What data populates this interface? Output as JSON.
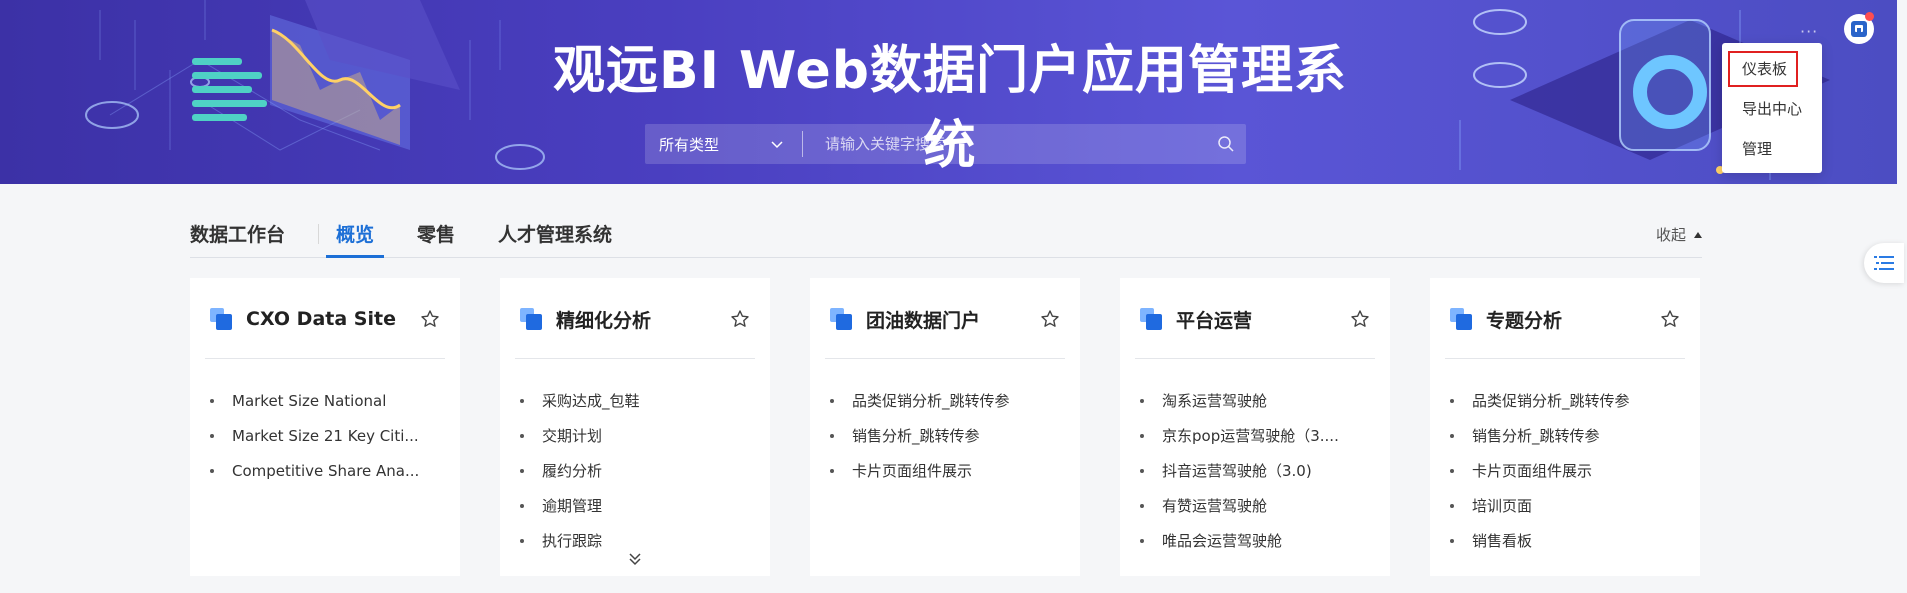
{
  "header": {
    "title": "观远BI Web数据门户应用管理系统",
    "search": {
      "type_selected": "所有类型",
      "placeholder": "请输入关键字搜索"
    },
    "more_label": "···"
  },
  "user_menu": {
    "items": [
      "仪表板",
      "导出中心",
      "管理"
    ],
    "highlighted": "仪表板"
  },
  "workspace": {
    "title": "数据工作台",
    "tabs": [
      "概览",
      "零售",
      "人才管理系统"
    ],
    "active_tab": "概览",
    "collapse_label": "收起"
  },
  "cards": [
    {
      "title": "CXO Data Site",
      "items": [
        "Market Size National",
        "Market Size 21 Key Citi...",
        "Competitive Share Ana..."
      ]
    },
    {
      "title": "精细化分析",
      "items": [
        "采购达成_包鞋",
        "交期计划",
        "履约分析",
        "逾期管理",
        "执行跟踪"
      ]
    },
    {
      "title": "团油数据门户",
      "items": [
        "品类促销分析_跳转传参",
        "销售分析_跳转传参",
        "卡片页面组件展示"
      ]
    },
    {
      "title": "平台运营",
      "items": [
        "淘系运营驾驶舱",
        "京东pop运营驾驶舱（3....",
        "抖音运营驾驶舱（3.0)",
        "有赞运营驾驶舱",
        "唯品会运营驾驶舱"
      ]
    },
    {
      "title": "专题分析",
      "items": [
        "品类促销分析_跳转传参",
        "销售分析_跳转传参",
        "卡片页面组件展示",
        "培训页面",
        "销售看板"
      ]
    }
  ],
  "colors": {
    "accent": "#1c6fd6",
    "banner_start": "#3c31a6",
    "banner_end": "#5a55d6",
    "highlight_border": "#e02020"
  }
}
